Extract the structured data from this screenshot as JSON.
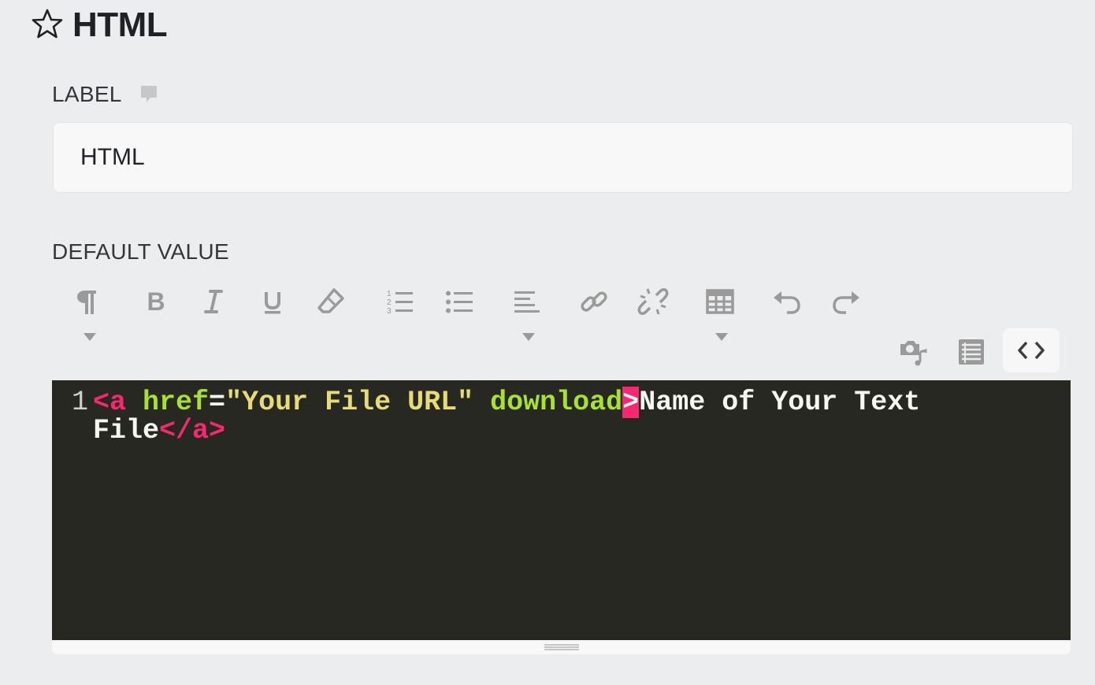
{
  "header": {
    "title": "HTML",
    "favorite_icon": "star-outline-icon"
  },
  "label_section": {
    "heading": "LABEL",
    "comment_icon": "comment-icon",
    "value": "HTML"
  },
  "default_value_section": {
    "heading": "DEFAULT VALUE"
  },
  "toolbar": {
    "buttons": [
      {
        "name": "paragraph-format",
        "icon": "paragraph-icon",
        "has_dropdown": true
      },
      {
        "name": "bold",
        "icon": "bold-icon"
      },
      {
        "name": "italic",
        "icon": "italic-icon"
      },
      {
        "name": "underline",
        "icon": "underline-icon"
      },
      {
        "name": "clear-formatting",
        "icon": "eraser-icon"
      },
      {
        "name": "ordered-list",
        "icon": "ordered-list-icon"
      },
      {
        "name": "unordered-list",
        "icon": "unordered-list-icon"
      },
      {
        "name": "align",
        "icon": "align-left-icon",
        "has_dropdown": true
      },
      {
        "name": "insert-link",
        "icon": "link-icon"
      },
      {
        "name": "unlink",
        "icon": "unlink-icon"
      },
      {
        "name": "table",
        "icon": "table-icon",
        "has_dropdown": true
      },
      {
        "name": "undo",
        "icon": "undo-icon"
      },
      {
        "name": "redo",
        "icon": "redo-icon"
      },
      {
        "name": "insert-media",
        "icon": "media-icon"
      },
      {
        "name": "snippets",
        "icon": "list-block-icon"
      },
      {
        "name": "code-view",
        "icon": "code-icon",
        "active": true
      }
    ]
  },
  "editor": {
    "line_number": "1",
    "tokens": {
      "open_tag": "<a",
      "attr_href": "href",
      "equals": "=",
      "href_value": "\"Your File URL\"",
      "attr_download": "download",
      "close_bracket": ">",
      "text_line1": "Name of Your Text",
      "text_line2": "File",
      "end_tag": "</a>"
    }
  },
  "colors": {
    "background": "#ecedef",
    "editor_bg": "#272822",
    "tag": "#f92672",
    "attribute": "#a6e22e",
    "string": "#e6db74",
    "plain_code": "#f8f8f2",
    "icon": "#9a9a9a"
  }
}
